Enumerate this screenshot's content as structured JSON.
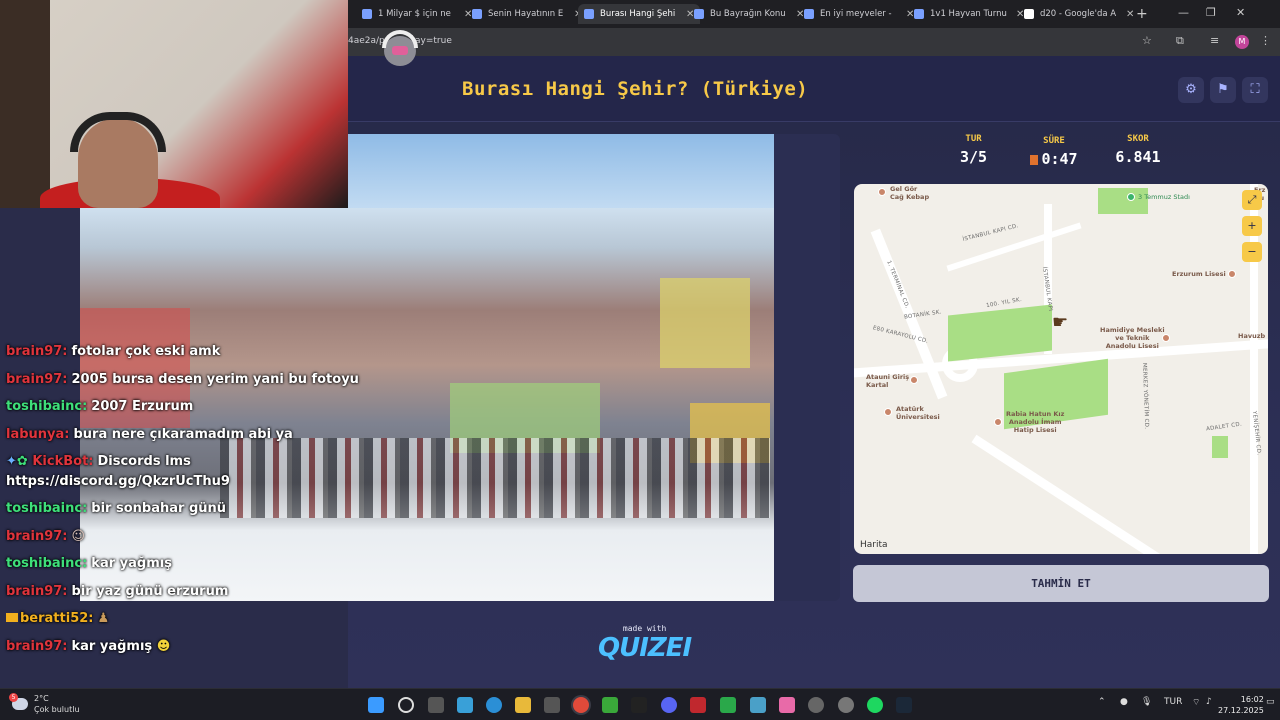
{
  "browser": {
    "tabs": [
      {
        "title": "1 Milyar $ için ne",
        "active": false
      },
      {
        "title": "Senin Hayatının E",
        "active": false
      },
      {
        "title": "Burası Hangi Şehi",
        "active": true
      },
      {
        "title": "Bu Bayrağın Konu",
        "active": false
      },
      {
        "title": "En iyi meyveler -",
        "active": false
      },
      {
        "title": "1v1 Hayvan Turnu",
        "active": false
      },
      {
        "title": "d20 - Google'da A",
        "active": false
      }
    ],
    "url_fragment": "4ae2a/p",
    "url_suffix": "ay=true",
    "profile_initial": "M"
  },
  "game": {
    "title": "Burası Hangi Şehir? (Türkiye)",
    "stats": {
      "round_label": "TUR",
      "round_value": "3/5",
      "time_label": "SÜRE",
      "time_value": "0:47",
      "score_label": "SKOR",
      "score_value": "6.841"
    },
    "guess_button": "TAHMİN ET",
    "made_with": "made with",
    "brand": "QUIZEI"
  },
  "map": {
    "attribution": "Harita",
    "pois": [
      {
        "key": "gel_gor",
        "label": "Gel Gör\nCağ Kebap"
      },
      {
        "key": "temmuz",
        "label": "3 Temmuz Stadı"
      },
      {
        "key": "erzurum_lisesi",
        "label": "Erzurum Lisesi"
      },
      {
        "key": "hamidiye",
        "label": "Hamidiye Mesleki\nve Teknik\nAnadolu Lisesi"
      },
      {
        "key": "atauni",
        "label": "Atauni Giriş\nKartal"
      },
      {
        "key": "ataturk",
        "label": "Atatürk\nÜniversitesi"
      },
      {
        "key": "rabia",
        "label": "Rabia Hatun Kız\nAnadolu İmam\nHatip Lisesi"
      },
      {
        "key": "havuzb",
        "label": "Havuzb"
      },
      {
        "key": "erz_edge",
        "label": "Erz\nNu\nHi"
      }
    ],
    "streets": {
      "terminal": "1. TERMİNAL CD.",
      "istanbul_kapi": "İSTANBUL KAPI CD.",
      "istanbul_kapi_v": "İSTANBUL KAPI",
      "botanik": "BOTANİK SK.",
      "yil100": "100. YIL SK.",
      "e80": "E80 KARAYOLU CD.",
      "merkez": "MERKEZ YÖNETİM CD.",
      "adalet": "ADALET CD.",
      "yenisehir": "YENİŞEHİR CD."
    }
  },
  "chat": [
    {
      "user": "brain97:",
      "color": "#e0343c",
      "text": "fotolar çok eski amk"
    },
    {
      "user": "brain97:",
      "color": "#e0343c",
      "text": "2005 bursa desen yerim yani bu fotoyu"
    },
    {
      "user": "toshibainc:",
      "color": "#3ee07a",
      "text": "2007 Erzurum"
    },
    {
      "user": "labunya:",
      "color": "#e0343c",
      "text": "bura nere çıkaramadım abi ya"
    },
    {
      "user": "KickBot:",
      "color": "#e0343c",
      "text": "Discords lms",
      "text2": "https://discord.gg/QkzrUcThu9"
    },
    {
      "user": "toshibainc:",
      "color": "#3ee07a",
      "text": "bir sonbahar günü"
    },
    {
      "user": "brain97:",
      "color": "#e0343c",
      "text": ""
    },
    {
      "user": "toshibainc:",
      "color": "#3ee07a",
      "text": "kar yağmış"
    },
    {
      "user": "brain97:",
      "color": "#e0343c",
      "text": "bir yaz günü erzurum"
    },
    {
      "user": "beratti52:",
      "color": "#f2b01e",
      "text": ""
    },
    {
      "user": "brain97:",
      "color": "#e0343c",
      "text": "kar yağmış"
    }
  ],
  "taskbar": {
    "temp": "2°C",
    "weather": "Çok bulutlu",
    "lang": "TUR",
    "time": "16:02",
    "date": "27.12.2025"
  }
}
